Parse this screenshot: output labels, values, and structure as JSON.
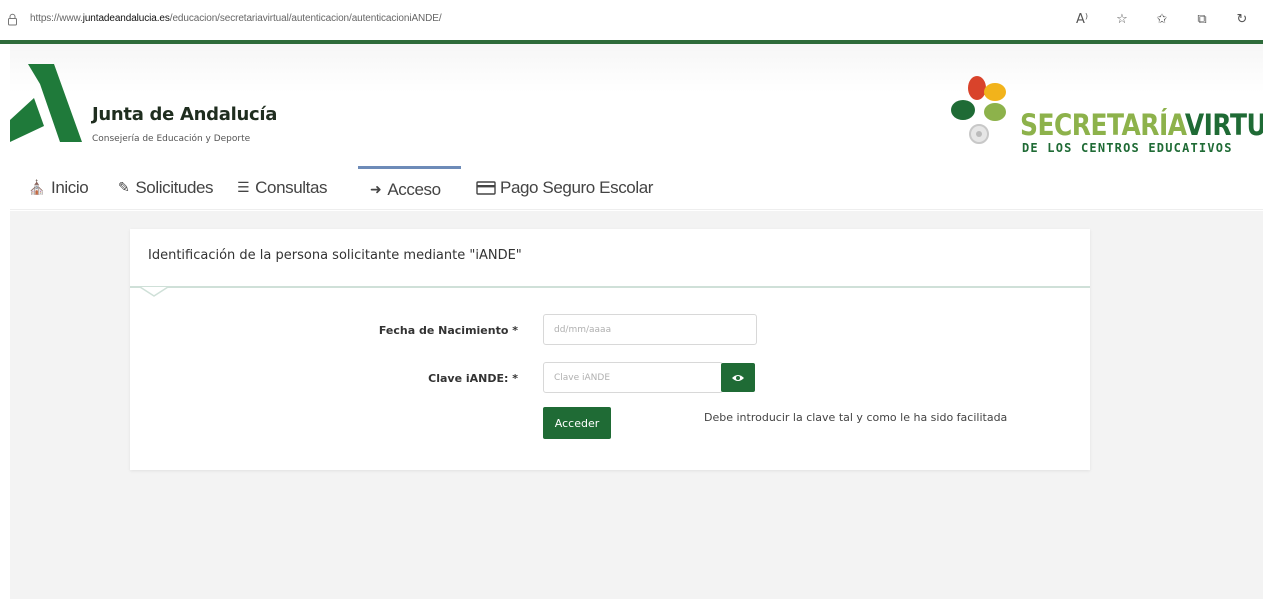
{
  "browser": {
    "url_prefix": "https://www.",
    "url_host": "juntadeandalucia.es",
    "url_path": "/educacion/secretariavirtual/autenticacion/autenticacioniANDE/",
    "icons": [
      "read-aloud-icon",
      "favorite-add-icon",
      "favorites-icon",
      "collections-icon",
      "history-icon"
    ]
  },
  "header": {
    "org_name": "Junta de Andalucía",
    "org_subtitle": "Consejería de Educación y Deporte",
    "sv_title_a": "SECRETARÍA",
    "sv_title_b": "VIRTUAL",
    "sv_subtitle": "DE LOS CENTROS EDUCATIVOS"
  },
  "nav": {
    "items": [
      {
        "label": "Inicio",
        "icon": "home-icon"
      },
      {
        "label": "Solicitudes",
        "icon": "pencil-icon"
      },
      {
        "label": "Consultas",
        "icon": "list-icon"
      },
      {
        "label": "Acceso",
        "icon": "sign-in-icon"
      },
      {
        "label": "Pago Seguro Escolar",
        "icon": "credit-card-icon"
      }
    ],
    "active": "Acceso"
  },
  "form": {
    "title": "Identificación de la persona solicitante mediante \"iANDE\"",
    "birth_label": "Fecha de Nacimiento *",
    "birth_placeholder": "dd/mm/aaaa",
    "key_label": "Clave iANDE: *",
    "key_placeholder": "Clave iANDE",
    "submit_label": "Acceder",
    "hint": "Debe introducir la clave tal y como le ha sido facilitada"
  },
  "colors": {
    "brand_green": "#1f6b35",
    "light_green": "#8db24b",
    "nav_active": "#6d8bb8"
  }
}
